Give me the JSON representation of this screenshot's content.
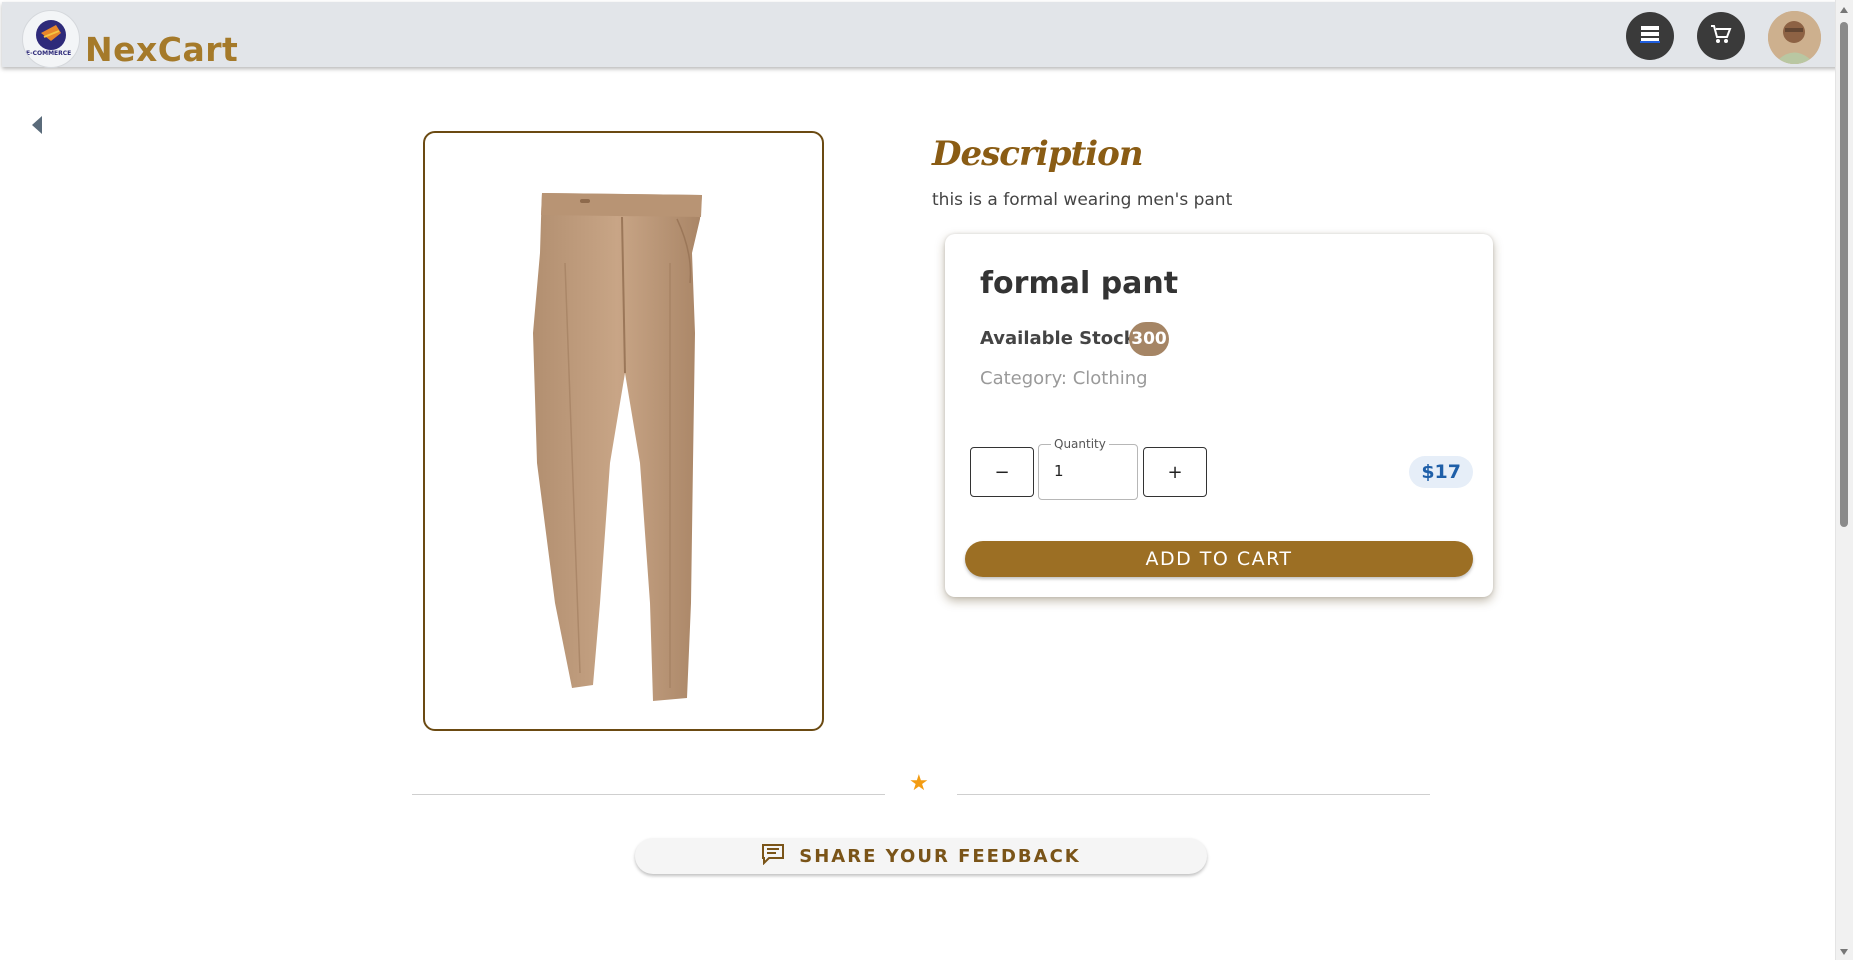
{
  "header": {
    "logo_text": "E-COMMERCE",
    "brand": "NexCart",
    "menu_icon": "list-icon",
    "cart_icon": "cart-icon",
    "avatar_icon": "user-avatar"
  },
  "nav": {
    "back_icon": "back-arrow-icon"
  },
  "product": {
    "image_alt": "formal pant",
    "description_title": "Description",
    "description": "this is a formal wearing men's pant",
    "name": "formal pant",
    "stock_label": "Available Stock :",
    "stock_value": "300",
    "category": "Category: Clothing",
    "quantity_label": "Quantity",
    "quantity_value": "1",
    "decrement": "−",
    "increment": "+",
    "price": "$17",
    "add_to_cart": "ADD TO CART"
  },
  "feedback": {
    "divider_icon": "star-icon",
    "button_label": "SHARE YOUR FEEDBACK"
  },
  "colors": {
    "brand": "#a57a2a",
    "accent": "#9c6f24",
    "price": "#1f5fa8",
    "star": "#f39c12"
  }
}
